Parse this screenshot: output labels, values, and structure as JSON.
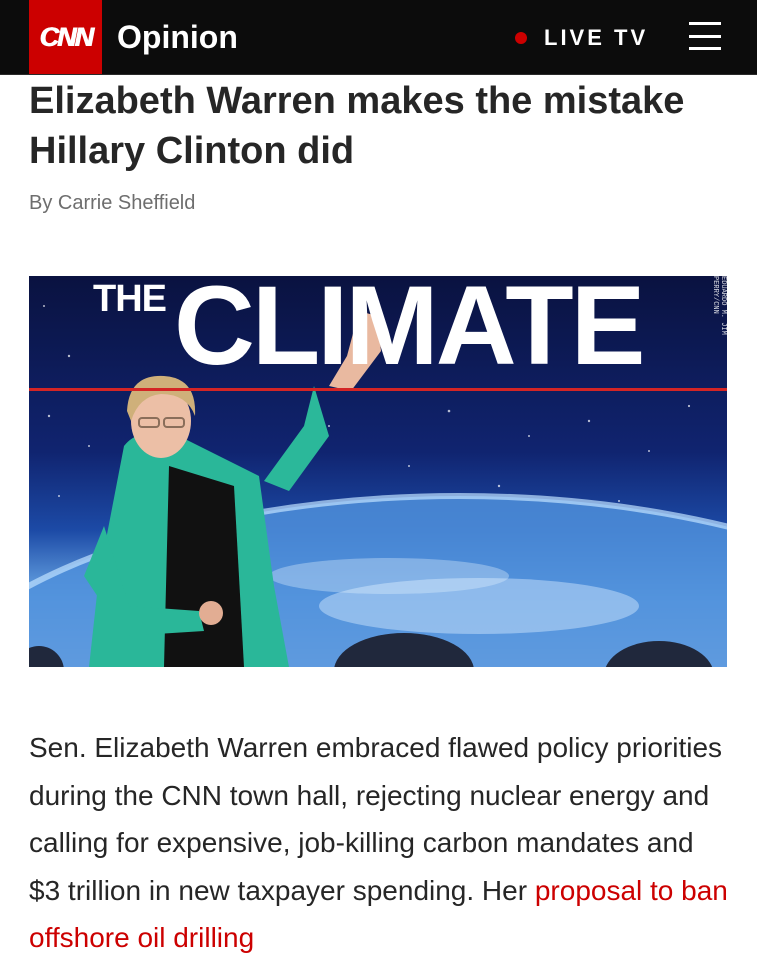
{
  "header": {
    "logo_text": "CNN",
    "section": "Opinion",
    "live_label": "LIVE TV",
    "menu_icon": "hamburger-menu-icon",
    "colors": {
      "bar": "#0c0c0c",
      "brand_red": "#cc0000",
      "live_dot": "#cc0000"
    }
  },
  "article": {
    "headline": "Elizabeth Warren makes the mistake Hillary Clinton did",
    "byline": "By Carrie Sheffield",
    "hero_image": {
      "description_text_the": "THE",
      "description_text_climate": "CLIMATE",
      "credit": "EDUARDO M. JIM PERRY/CNN"
    },
    "body_lead": "Sen. Elizabeth Warren embraced flawed policy priorities during the CNN town hall, rejecting nuclear energy and calling for expensive, job-killing carbon mandates and $3 trillion in new taxpayer spending. Her ",
    "body_link": "proposal to ban offshore oil drilling",
    "link_color": "#cc0000"
  }
}
